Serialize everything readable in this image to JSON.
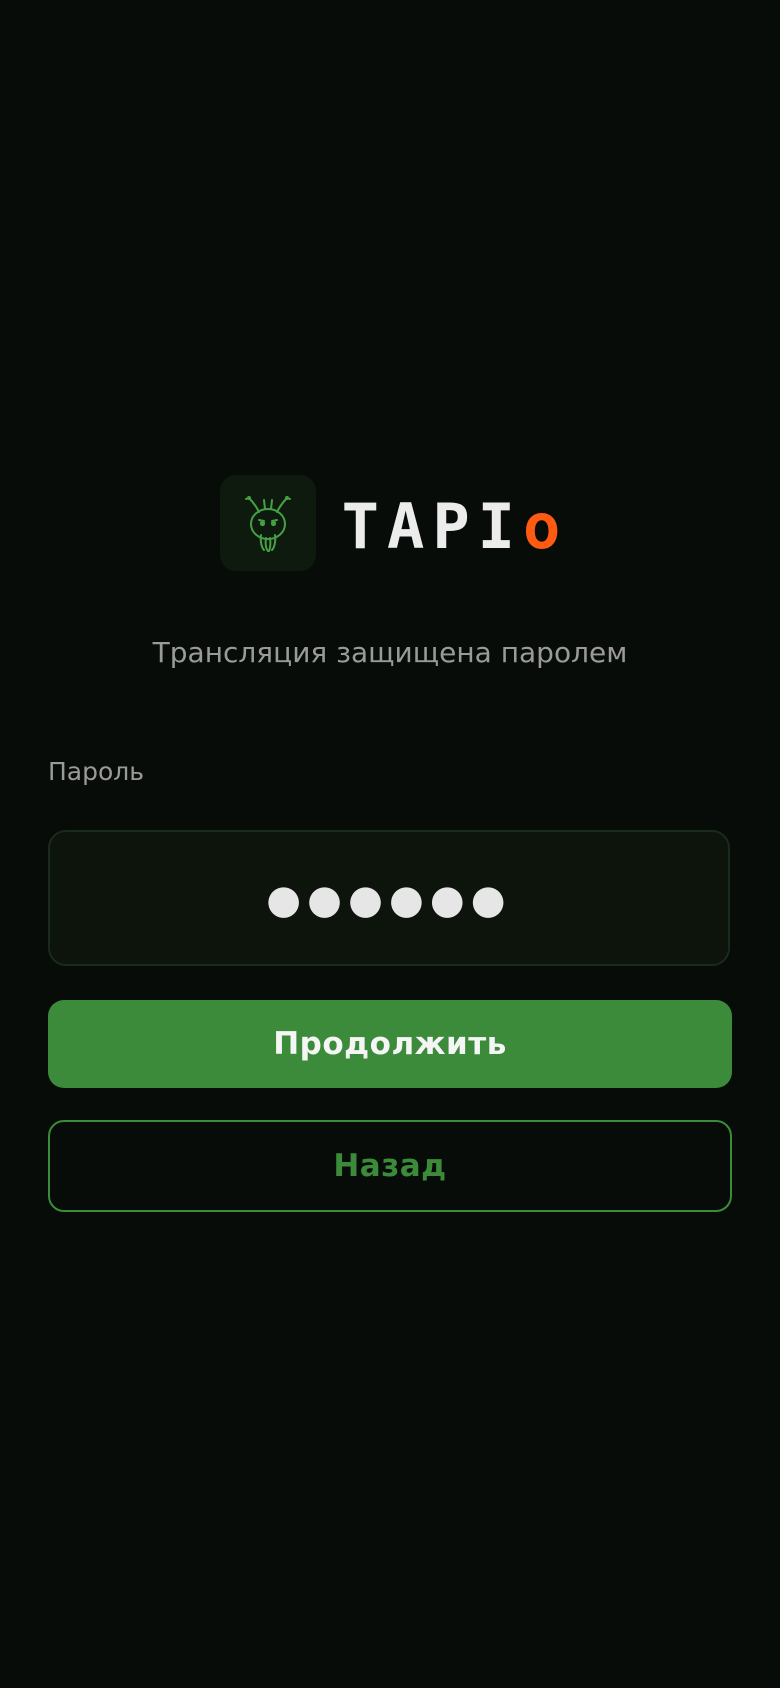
{
  "brand": {
    "name_main": "TAPI",
    "name_accent": "o",
    "icon": "horned-creature-logo-icon",
    "accent_color": "#ff5a12",
    "primary_color": "#3b8b3b"
  },
  "subtitle": "Трансляция защищена паролем",
  "password": {
    "label": "Пароль",
    "value": "●●●●●●"
  },
  "buttons": {
    "continue_label": "Продолжить",
    "back_label": "Назад"
  }
}
